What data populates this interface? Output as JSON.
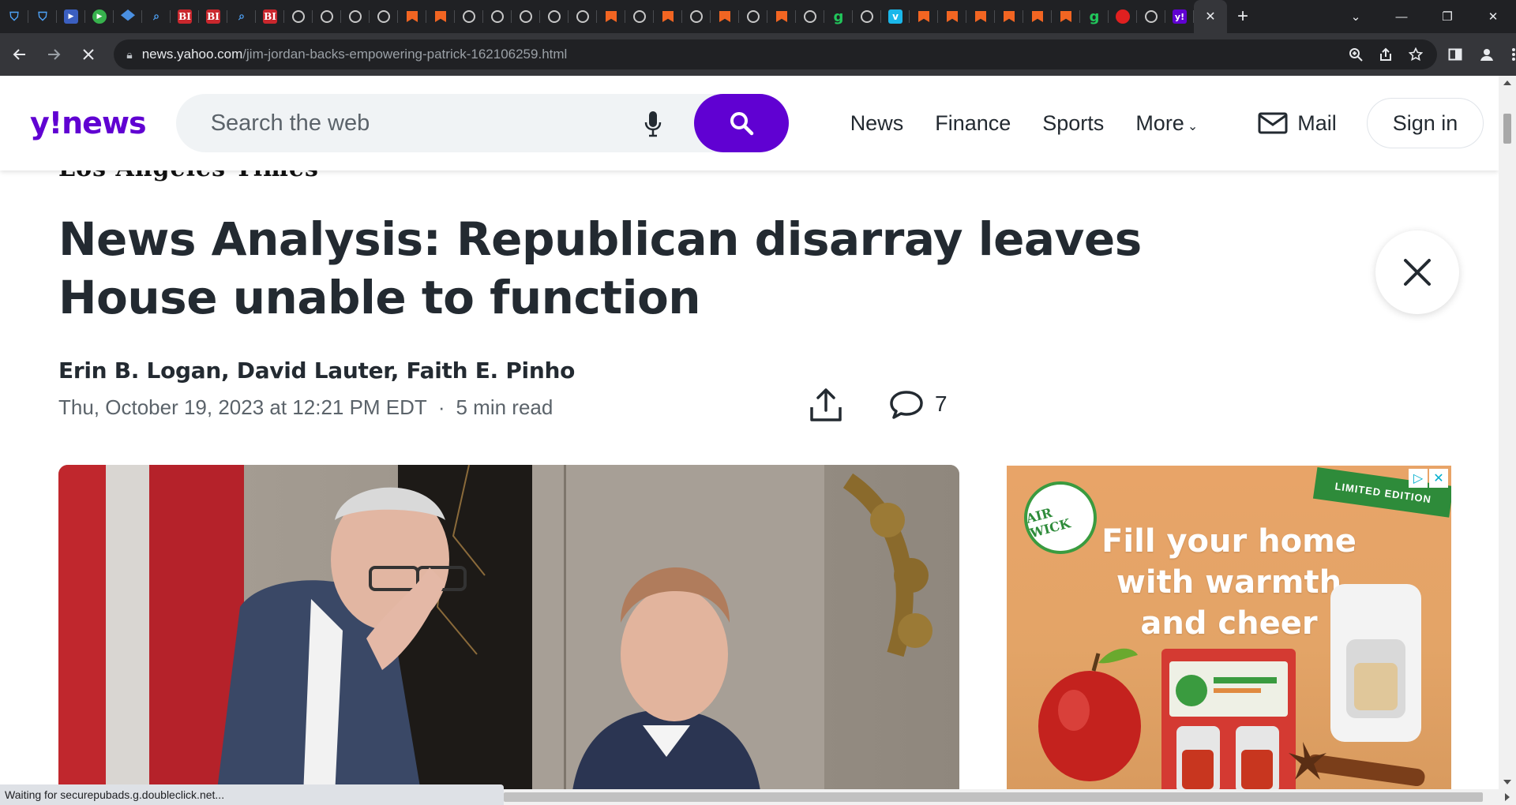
{
  "browser": {
    "tabs": [
      {
        "icon": "shield-icon"
      },
      {
        "icon": "shield-icon"
      },
      {
        "icon": "arrow-icon"
      },
      {
        "icon": "play-icon"
      },
      {
        "icon": "cap-icon"
      },
      {
        "icon": "search-icon"
      },
      {
        "icon": "bi-icon",
        "text": "BI"
      },
      {
        "icon": "bi-icon",
        "text": "BI"
      },
      {
        "icon": "search-icon"
      },
      {
        "icon": "bi-icon",
        "text": "BI"
      },
      {
        "icon": "globe-icon"
      },
      {
        "icon": "globe-icon"
      },
      {
        "icon": "globe-icon"
      },
      {
        "icon": "globe-icon"
      },
      {
        "icon": "bookmark-icon"
      },
      {
        "icon": "bookmark-icon"
      },
      {
        "icon": "globe-icon"
      },
      {
        "icon": "globe-icon"
      },
      {
        "icon": "globe-icon"
      },
      {
        "icon": "globe-icon"
      },
      {
        "icon": "globe-icon"
      },
      {
        "icon": "bookmark-icon"
      },
      {
        "icon": "globe-icon"
      },
      {
        "icon": "bookmark-icon"
      },
      {
        "icon": "globe-icon"
      },
      {
        "icon": "bookmark-icon"
      },
      {
        "icon": "globe-icon"
      },
      {
        "icon": "bookmark-icon"
      },
      {
        "icon": "globe-icon"
      },
      {
        "icon": "g-icon",
        "text": "g"
      },
      {
        "icon": "globe-icon"
      },
      {
        "icon": "v-icon",
        "text": "v"
      },
      {
        "icon": "bookmark-icon"
      },
      {
        "icon": "bookmark-icon"
      },
      {
        "icon": "bookmark-icon"
      },
      {
        "icon": "bookmark-icon"
      },
      {
        "icon": "bookmark-icon"
      },
      {
        "icon": "bookmark-icon"
      },
      {
        "icon": "g-icon",
        "text": "g"
      },
      {
        "icon": "pin-icon"
      },
      {
        "icon": "globe-icon"
      },
      {
        "icon": "yahoo-icon",
        "text": "y!"
      }
    ],
    "active_tab_close": "✕",
    "new_tab": "+",
    "url_host": "news.yahoo.com",
    "url_path": "/jim-jordan-backs-empowering-patrick-162106259.html",
    "status_text": "Waiting for securepubads.g.doubleclick.net..."
  },
  "masthead": {
    "logo_y": "y",
    "logo_bang": "!",
    "logo_news": "news",
    "search_placeholder": "Search the web",
    "nav": [
      "News",
      "Finance",
      "Sports",
      "More"
    ],
    "mail_label": "Mail",
    "signin_label": "Sign in"
  },
  "article": {
    "publisher": "Los Angeles Times",
    "headline": "News Analysis: Republican disarray leaves House unable to function",
    "authors": "Erin B. Logan, David Lauter, Faith E. Pinho",
    "date": "Thu, October 19, 2023 at 12:21 PM EDT",
    "separator": "·",
    "read_time": "5 min read",
    "comment_count": "7"
  },
  "ad": {
    "brand": "AIR WICK",
    "ribbon": "LIMITED EDITION",
    "headline_lines": [
      "Fill your home",
      "with warmth",
      "and cheer"
    ]
  },
  "colors": {
    "yahoo_purple": "#6001d2",
    "text_dark": "#232a31",
    "text_muted": "#5b636a",
    "ad_orange": "#e3a467",
    "ad_green": "#2e8b3a"
  }
}
